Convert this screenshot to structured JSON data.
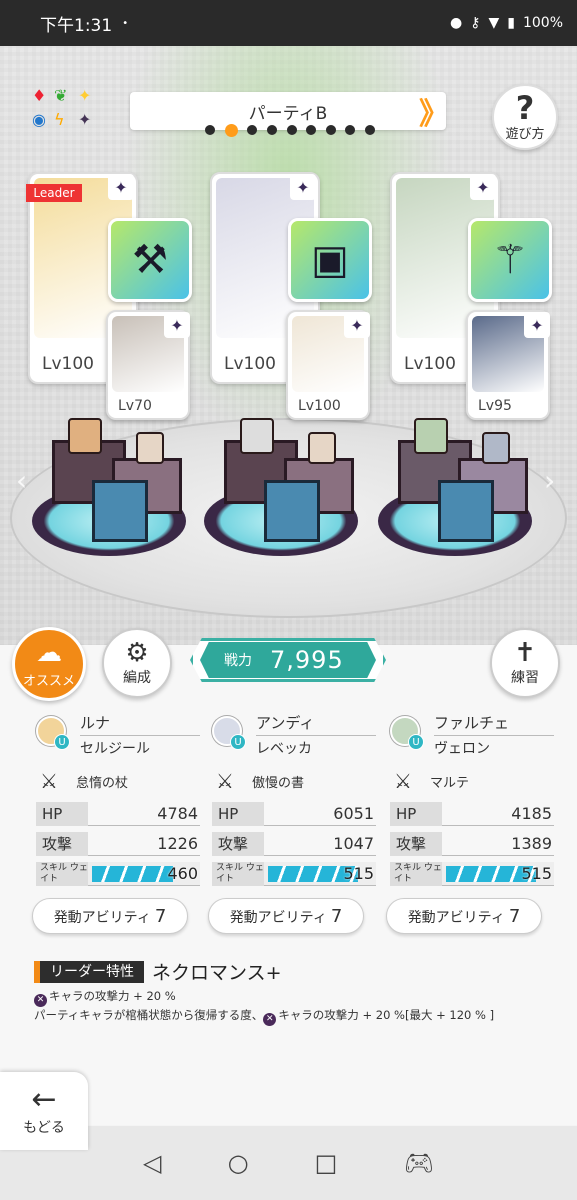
{
  "status_bar": {
    "time": "下午1:31",
    "dot": "•",
    "battery": "100%"
  },
  "party": {
    "title": "パーティB",
    "prev_arrow": "《",
    "next_arrow": "》",
    "page_count": 9,
    "active_page": 1
  },
  "help": {
    "symbol": "?",
    "label": "遊び方"
  },
  "leader_tag": "Leader",
  "cards": [
    {
      "main_level": "Lv100",
      "sub_level": "Lv70",
      "weapon_icon": "axe-icon",
      "art_color": "#f4dc9a",
      "sub_color": "#c8c0b8"
    },
    {
      "main_level": "Lv100",
      "sub_level": "Lv100",
      "weapon_icon": "book-icon",
      "art_color": "#d8d8e6",
      "sub_color": "#efe6d6"
    },
    {
      "main_level": "Lv100",
      "sub_level": "Lv95",
      "weapon_icon": "staff-icon",
      "art_color": "#c6d6c0",
      "sub_color": "#5a6a8a"
    }
  ],
  "buttons": {
    "recommend": "オススメ",
    "formation": "編成",
    "practice": "練習",
    "back": "もどる"
  },
  "power": {
    "label": "戦力",
    "value": "7,995"
  },
  "members": [
    {
      "name": "ルナ",
      "sub": "セルジール",
      "weapon": "怠惰の杖",
      "hp_label": "HP",
      "hp": "4784",
      "atk_label": "攻撃",
      "atk": "1226",
      "wait_label": "スキル ウェイト",
      "wait": "460",
      "wait_fraction": 0.72,
      "ability": "発動アビリティ",
      "ability_count": "7",
      "avatar_color": "#f2d49a"
    },
    {
      "name": "アンディ",
      "sub": "レベッカ",
      "weapon": "傲慢の書",
      "hp_label": "HP",
      "hp": "6051",
      "atk_label": "攻撃",
      "atk": "1047",
      "wait_label": "スキル ウェイト",
      "wait": "515",
      "wait_fraction": 0.8,
      "ability": "発動アビリティ",
      "ability_count": "7",
      "avatar_color": "#d8dce8"
    },
    {
      "name": "ファルチェ",
      "sub": "ヴェロン",
      "weapon": "マルテ",
      "hp_label": "HP",
      "hp": "4185",
      "atk_label": "攻撃",
      "atk": "1389",
      "wait_label": "スキル ウェイト",
      "wait": "515",
      "wait_fraction": 0.8,
      "ability": "発動アビリティ",
      "ability_count": "7",
      "avatar_color": "#c4d8c0"
    }
  ],
  "leader_skill": {
    "tag": "リーダー特性",
    "name": "ネクロマンス+",
    "line1": "キャラの攻撃力 + 20 %",
    "line2_a": "パーティキャラが棺桶状態から復帰する度、",
    "line2_b": "キャラの攻撃力 + 20 %[最大 + 120 % ]"
  }
}
